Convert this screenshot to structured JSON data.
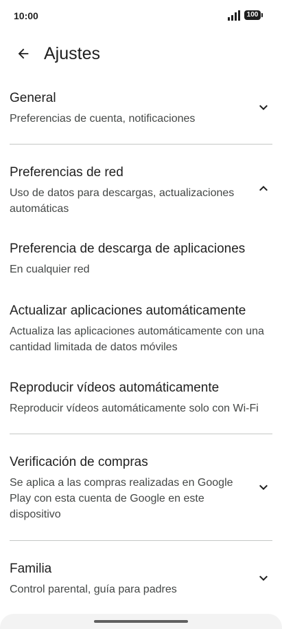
{
  "status_bar": {
    "time": "10:00",
    "battery": "100"
  },
  "app_bar": {
    "title": "Ajustes"
  },
  "sections": {
    "general": {
      "title": "General",
      "subtitle": "Preferencias de cuenta, notificaciones",
      "expanded": false
    },
    "network": {
      "title": "Preferencias de red",
      "subtitle": "Uso de datos para descargas, actualizaciones automáticas",
      "expanded": true
    },
    "download_pref": {
      "title": "Preferencia de descarga de aplicaciones",
      "subtitle": "En cualquier red"
    },
    "auto_update": {
      "title": "Actualizar aplicaciones automáticamente",
      "subtitle": "Actualiza las aplicaciones automáticamente con una cantidad limitada de datos móviles"
    },
    "autoplay": {
      "title": "Reproducir vídeos automáticamente",
      "subtitle": "Reproducir vídeos automáticamente solo con Wi-Fi"
    },
    "purchase_verification": {
      "title": "Verificación de compras",
      "subtitle": "Se aplica a las compras realizadas en Google Play con esta cuenta de Google en este dispositivo",
      "expanded": false
    },
    "family": {
      "title": "Familia",
      "subtitle": "Control parental, guía para padres",
      "expanded": false
    }
  },
  "colors": {
    "text": "#1f1f1f",
    "secondary": "#444746",
    "divider": "#c4c7c5"
  }
}
